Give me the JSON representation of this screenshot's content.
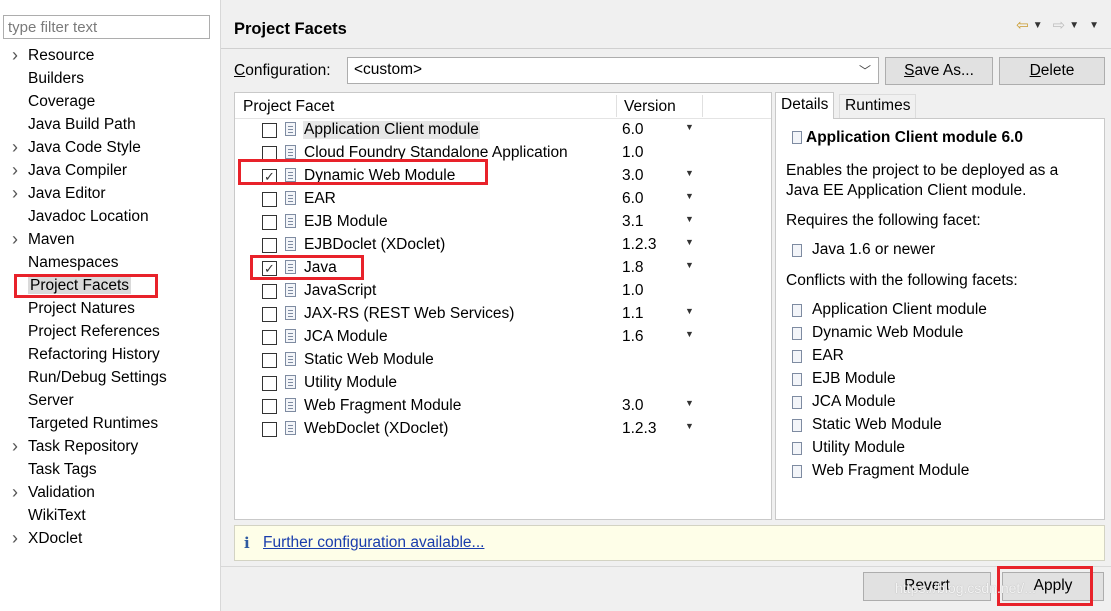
{
  "filter": {
    "placeholder": "type filter text"
  },
  "sidebar": {
    "items": [
      {
        "label": "Resource",
        "expandable": true
      },
      {
        "label": "Builders",
        "expandable": false
      },
      {
        "label": "Coverage",
        "expandable": false
      },
      {
        "label": "Java Build Path",
        "expandable": false
      },
      {
        "label": "Java Code Style",
        "expandable": true
      },
      {
        "label": "Java Compiler",
        "expandable": true
      },
      {
        "label": "Java Editor",
        "expandable": true
      },
      {
        "label": "Javadoc Location",
        "expandable": false
      },
      {
        "label": "Maven",
        "expandable": true
      },
      {
        "label": "Namespaces",
        "expandable": false
      },
      {
        "label": "Project Facets",
        "expandable": false,
        "selected": true
      },
      {
        "label": "Project Natures",
        "expandable": false
      },
      {
        "label": "Project References",
        "expandable": false
      },
      {
        "label": "Refactoring History",
        "expandable": false
      },
      {
        "label": "Run/Debug Settings",
        "expandable": false
      },
      {
        "label": "Server",
        "expandable": false
      },
      {
        "label": "Targeted Runtimes",
        "expandable": false
      },
      {
        "label": "Task Repository",
        "expandable": true
      },
      {
        "label": "Task Tags",
        "expandable": false
      },
      {
        "label": "Validation",
        "expandable": true
      },
      {
        "label": "WikiText",
        "expandable": false
      },
      {
        "label": "XDoclet",
        "expandable": true
      }
    ]
  },
  "header": {
    "title": "Project Facets"
  },
  "config": {
    "label_prefix": "C",
    "label_rest": "onfiguration:",
    "value": "<custom>",
    "save_as_prefix": "S",
    "save_as_rest": "ave As...",
    "delete_prefix": "D",
    "delete_rest": "elete"
  },
  "facets": {
    "col_facet": "Project Facet",
    "col_version": "Version",
    "rows": [
      {
        "name": "Application Client module",
        "version": "6.0",
        "checked": false,
        "dropdown": true,
        "highlight": true
      },
      {
        "name": "Cloud Foundry Standalone Application",
        "version": "1.0",
        "checked": false,
        "dropdown": false
      },
      {
        "name": "Dynamic Web Module",
        "version": "3.0",
        "checked": true,
        "dropdown": true
      },
      {
        "name": "EAR",
        "version": "6.0",
        "checked": false,
        "dropdown": true
      },
      {
        "name": "EJB Module",
        "version": "3.1",
        "checked": false,
        "dropdown": true
      },
      {
        "name": "EJBDoclet (XDoclet)",
        "version": "1.2.3",
        "checked": false,
        "dropdown": true
      },
      {
        "name": "Java",
        "version": "1.8",
        "checked": true,
        "dropdown": true
      },
      {
        "name": "JavaScript",
        "version": "1.0",
        "checked": false,
        "dropdown": false
      },
      {
        "name": "JAX-RS (REST Web Services)",
        "version": "1.1",
        "checked": false,
        "dropdown": true
      },
      {
        "name": "JCA Module",
        "version": "1.6",
        "checked": false,
        "dropdown": true
      },
      {
        "name": "Static Web Module",
        "version": "",
        "checked": false,
        "dropdown": false
      },
      {
        "name": "Utility Module",
        "version": "",
        "checked": false,
        "dropdown": false
      },
      {
        "name": "Web Fragment Module",
        "version": "3.0",
        "checked": false,
        "dropdown": true
      },
      {
        "name": "WebDoclet (XDoclet)",
        "version": "1.2.3",
        "checked": false,
        "dropdown": true
      }
    ]
  },
  "details": {
    "tab_details": "Details",
    "tab_runtimes": "Runtimes",
    "title": "Application Client module 6.0",
    "description_line1": "Enables the project to be deployed as a",
    "description_line2": "Java EE Application Client module.",
    "requires_label": "Requires the following facet:",
    "requires": [
      "Java 1.6 or newer"
    ],
    "conflicts_label": "Conflicts with the following facets:",
    "conflicts": [
      "Application Client module",
      "Dynamic Web Module",
      "EAR",
      "EJB Module",
      "JCA Module",
      "Static Web Module",
      "Utility Module",
      "Web Fragment Module"
    ]
  },
  "info": {
    "icon": "i",
    "link": "Further configuration available..."
  },
  "footer": {
    "revert_label": "Revert",
    "apply_label": "Apply",
    "watermark": "https://blog.csdn.net/..."
  },
  "colors": {
    "highlight_box": "#e8222a",
    "link": "#1a3dac",
    "info_bg": "#fefee8"
  }
}
